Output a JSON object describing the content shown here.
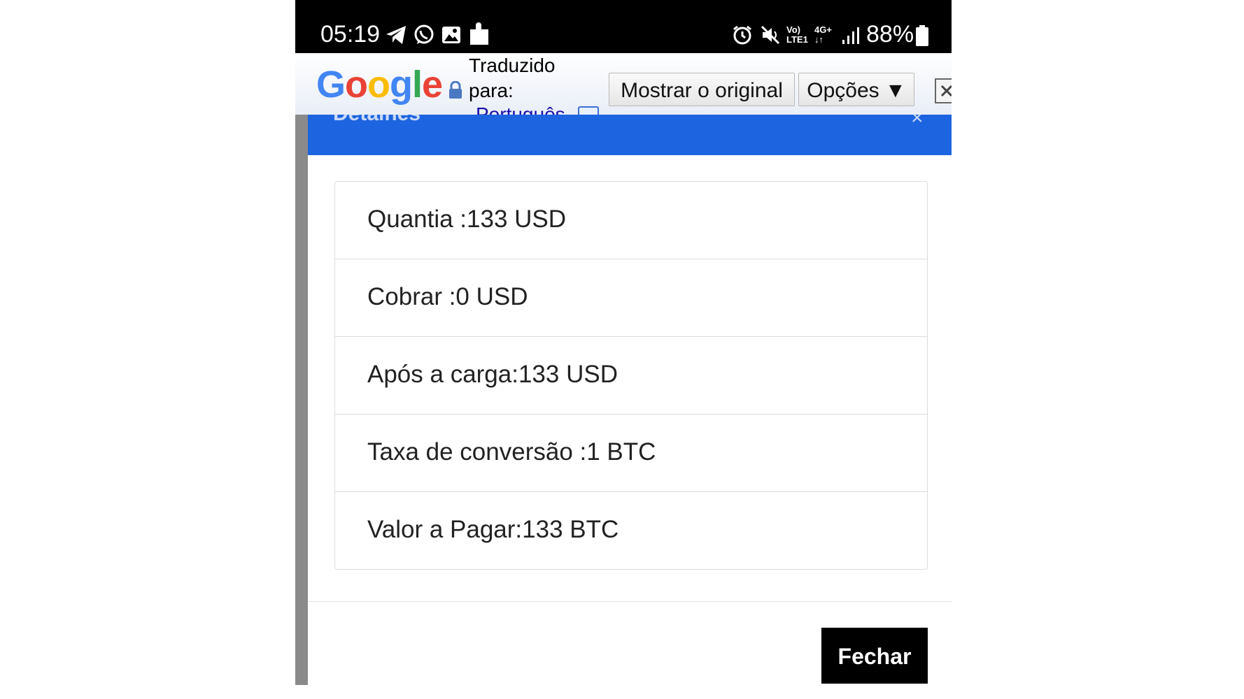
{
  "status_bar": {
    "time": "05:19",
    "battery": "88%",
    "icons": [
      "telegram-icon",
      "whatsapp-icon",
      "image-icon",
      "puzzle-icon",
      "alarm-icon",
      "mute-icon",
      "volte-icon",
      "4g-icon",
      "signal-icon",
      "battery-icon"
    ]
  },
  "translate_bar": {
    "logo": "Google",
    "label_line1": "Traduzido",
    "label_line2": "para:",
    "language": "Português",
    "show_original": "Mostrar o original",
    "options": "Opções ▼"
  },
  "modal": {
    "title": "Detalhes",
    "close_symbol": "×",
    "rows": [
      "Quantia :133 USD",
      "Cobrar :0 USD",
      "Após a carga:133 USD",
      "Taxa de conversão :1 BTC",
      "Valor a Pagar:133 BTC"
    ],
    "close_button": "Fechar"
  },
  "colors": {
    "header_blue": "#1d65e0",
    "button_black": "#000000",
    "google_blue": "#4285F4",
    "google_red": "#EA4335",
    "google_yellow": "#FBBC05",
    "google_green": "#34A853"
  }
}
